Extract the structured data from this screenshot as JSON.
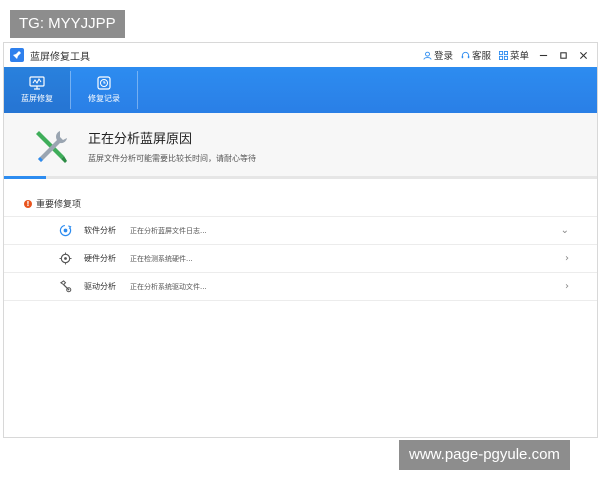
{
  "watermark_top": "TG: MYYJJPP",
  "watermark_bottom": "www.page-pgyule.com",
  "window": {
    "title": "蓝屏修复工具",
    "login": "登录",
    "support": "客服",
    "menu": "菜单"
  },
  "nav": {
    "items": [
      {
        "label": "蓝屏修复",
        "icon": "monitor-icon"
      },
      {
        "label": "修复记录",
        "icon": "clock-icon"
      }
    ]
  },
  "hero": {
    "title": "正在分析蓝屏原因",
    "subtitle": "蓝屏文件分析可能需要比较长时间，请耐心等待",
    "icon": "tools-icon",
    "progress": 0.07
  },
  "section": {
    "title": "重要修复项"
  },
  "rows": [
    {
      "name": "软件分析",
      "status": "正在分析蓝屏文件日志...",
      "icon": "refresh-icon",
      "chevron": "⌄"
    },
    {
      "name": "硬件分析",
      "status": "正在检测系统硬件...",
      "icon": "hardware-icon",
      "chevron": "›"
    },
    {
      "name": "驱动分析",
      "status": "正在分析系统驱动文件...",
      "icon": "driver-icon",
      "chevron": "›"
    }
  ],
  "colors": {
    "accent": "#2d8cf0",
    "warning": "#e8541e"
  }
}
